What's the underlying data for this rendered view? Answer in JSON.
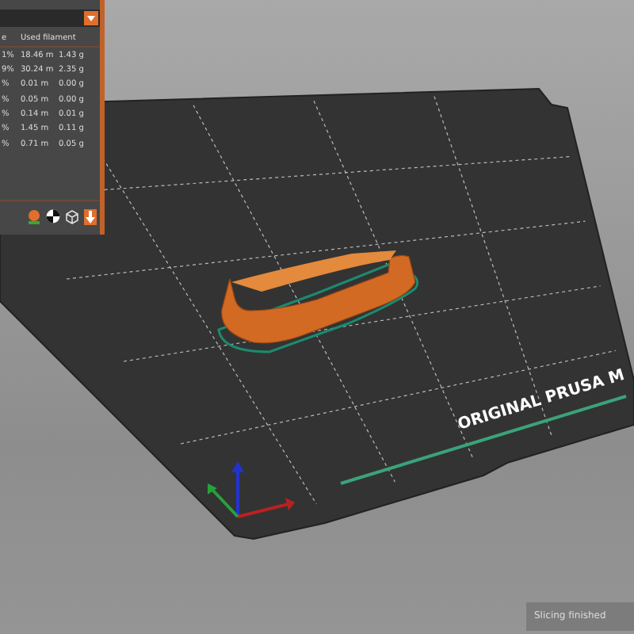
{
  "sidebar": {
    "headers": [
      "e",
      "Used filament"
    ],
    "rows": [
      [
        "1%",
        "18.46 m",
        "1.43 g"
      ],
      [
        "9%",
        "30.24 m",
        "2.35 g"
      ],
      [
        "%",
        "0.01 m",
        "0.00 g"
      ],
      [
        "%",
        "0.05 m",
        "0.00 g"
      ],
      [
        "%",
        "0.14 m",
        "0.01 g"
      ],
      [
        "%",
        "1.45 m",
        "0.11 g"
      ],
      [
        "%",
        "0.71 m",
        "0.05 g"
      ]
    ]
  },
  "bed": {
    "label": "ORIGINAL PRUSA M"
  },
  "notification": {
    "text": "Slicing finished"
  }
}
